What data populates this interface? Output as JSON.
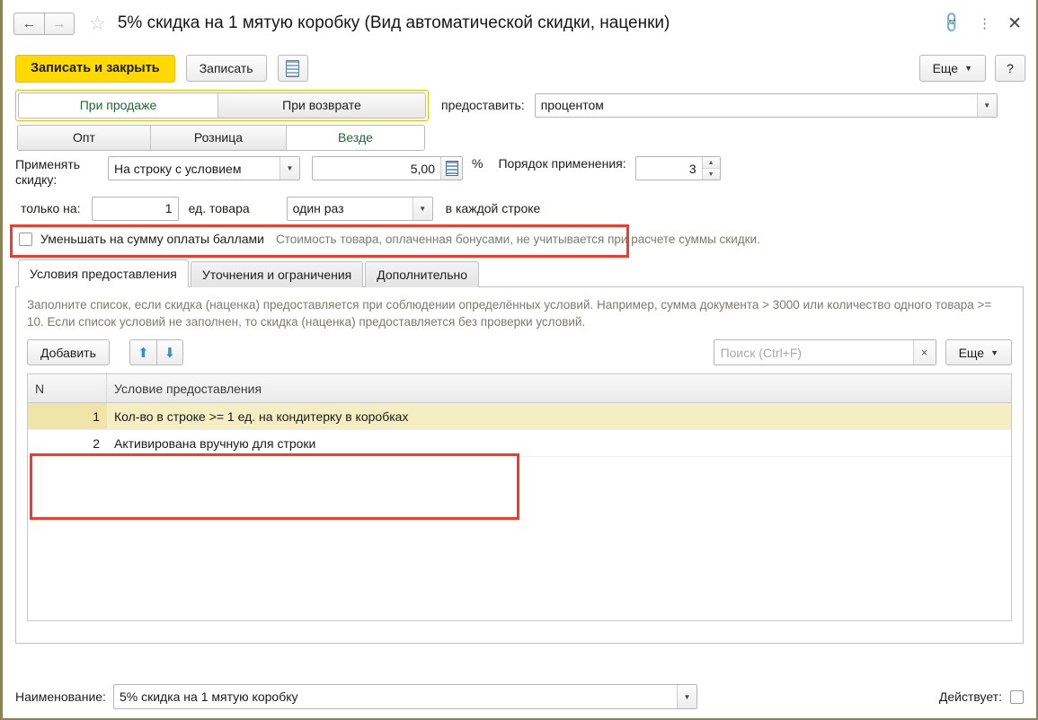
{
  "window": {
    "title": "5% скидка на 1 мятую коробку (Вид автоматической скидки, наценки)",
    "nav_back": "←",
    "nav_forward": "→",
    "star": "☆",
    "link_icon": "🔗",
    "kebab_icon": "⋮",
    "close_icon": "✕"
  },
  "toolbar": {
    "save_and_close": "Записать и закрыть",
    "save": "Записать",
    "report_icon": "report-icon",
    "more": "Еще",
    "help": "?"
  },
  "switches": {
    "sale_return": [
      {
        "label": "При продаже",
        "active": true
      },
      {
        "label": "При возврате",
        "active": false
      }
    ],
    "channel": [
      {
        "label": "Опт",
        "active": false
      },
      {
        "label": "Розница",
        "active": false
      },
      {
        "label": "Везде",
        "active": true
      }
    ]
  },
  "provide": {
    "label": "предоставить:",
    "value": "процентом"
  },
  "apply": {
    "label_line1": "Применять",
    "label_line2": "скидку:",
    "mode_value": "На строку с условием",
    "percent_value": "5,00",
    "percent_sign": "%",
    "order_label": "Порядок применения:",
    "order_value": "3"
  },
  "only_on": {
    "label": "только на:",
    "qty_value": "1",
    "unit_label": "ед. товара",
    "times_value": "один раз",
    "scope_label": "в каждой строке"
  },
  "bonus": {
    "checkbox_label": "Уменьшать на сумму оплаты баллами",
    "hint": "Стоимость товара, оплаченная бонусами, не учитывается при расчете суммы скидки.",
    "checked": false
  },
  "tabs": [
    {
      "label": "Условия предоставления",
      "active": true
    },
    {
      "label": "Уточнения и ограничения",
      "active": false
    },
    {
      "label": "Дополнительно",
      "active": false
    }
  ],
  "panel": {
    "description": "Заполните список, если скидка (наценка) предоставляется при соблюдении определённых условий. Например, сумма документа > 3000 или количество одного товара >= 10. Если список условий не заполнен, то скидка (наценка) предоставляется без проверки условий.",
    "add_button": "Добавить",
    "move_up_icon": "⬆",
    "move_down_icon": "⬇",
    "search_placeholder": "Поиск (Ctrl+F)",
    "search_clear": "×",
    "more": "Еще"
  },
  "table": {
    "columns": [
      "N",
      "Условие предоставления"
    ],
    "rows": [
      {
        "n": "1",
        "condition": "Кол-во в строке >= 1 ед. на кондитерку в коробках",
        "selected": true
      },
      {
        "n": "2",
        "condition": "Активирована вручную для строки",
        "selected": false
      }
    ]
  },
  "footer": {
    "name_label": "Наименование:",
    "name_value": "5% скидка на 1 мятую коробку",
    "active_label": "Действует:",
    "active_checked": false
  },
  "colors": {
    "primary_button": "#ffd900",
    "annotation": "#f03b2d",
    "selected_row": "#f5eec2",
    "active_tab_text": "#1d6b2f",
    "hint_text": "#7b7b6e"
  }
}
